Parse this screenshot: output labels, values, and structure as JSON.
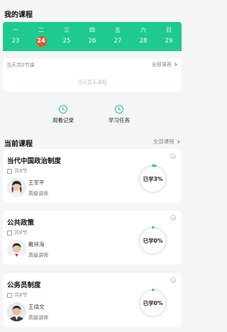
{
  "header": {
    "title": "我的课程"
  },
  "calendar": {
    "weekdays": [
      "一",
      "二",
      "三",
      "四",
      "五",
      "六",
      "日"
    ],
    "days": [
      "23",
      "24",
      "25",
      "26",
      "27",
      "28",
      "29"
    ],
    "selected_index": 1,
    "accent": "#1fca8e",
    "highlight": "#e2532e"
  },
  "today": {
    "count_text": "当天共0节课",
    "all_schedule": "全部课表",
    "empty_text": "当天暂无课程"
  },
  "quick": [
    {
      "label": "观看记录",
      "icon": "clock-icon"
    },
    {
      "label": "学习任务",
      "icon": "clock-icon"
    }
  ],
  "current": {
    "title": "当前课程",
    "all_courses": "全部课程",
    "courses": [
      {
        "name": "当代中国政治制度",
        "lessons": "共8节",
        "teacher": "王军平",
        "teacher_title": "高级讲师",
        "progress_label": "已学3%",
        "progress": 3
      },
      {
        "name": "公共政策",
        "lessons": "共8节",
        "teacher": "戴祥海",
        "teacher_title": "高级讲师",
        "progress_label": "已学0%",
        "progress": 0
      },
      {
        "name": "公务员制度",
        "lessons": "共8节",
        "teacher": "王靖文",
        "teacher_title": "高级讲师",
        "progress_label": "已学0%",
        "progress": 0
      }
    ]
  }
}
